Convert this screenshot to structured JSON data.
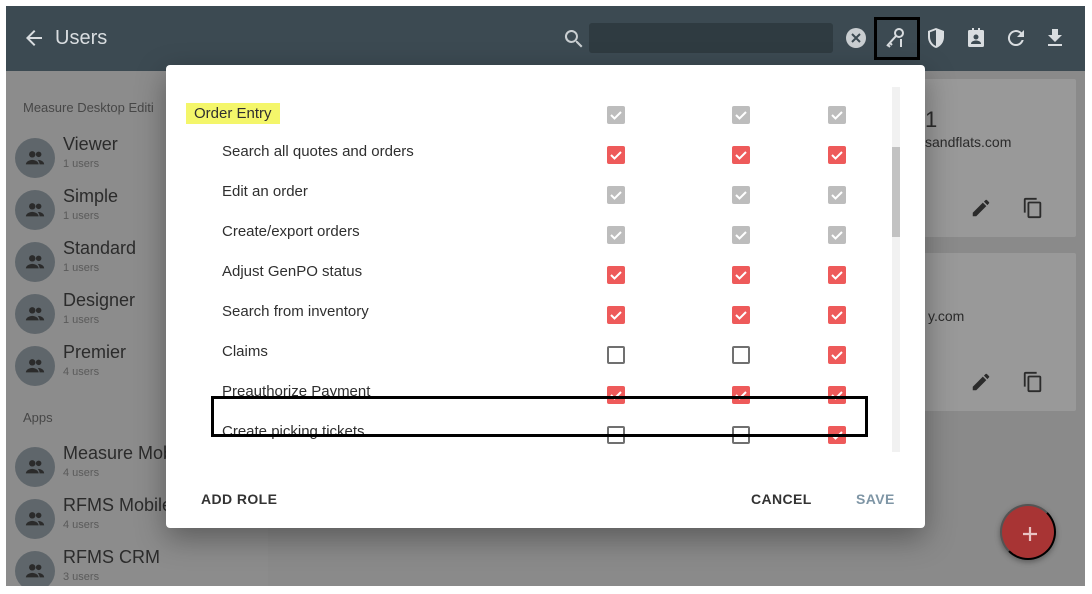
{
  "appbar": {
    "title": "Users",
    "search_value": "",
    "icons": [
      "back-arrow-icon",
      "search-icon",
      "clear-icon",
      "key-permissions-icon",
      "shield-icon",
      "contact-card-icon",
      "refresh-icon",
      "download-icon"
    ]
  },
  "sidebar": {
    "section1_label": "Measure Desktop Editi",
    "section1_items": [
      {
        "name": "Viewer",
        "count": "1 users"
      },
      {
        "name": "Simple",
        "count": "1 users"
      },
      {
        "name": "Standard",
        "count": "1 users"
      },
      {
        "name": "Designer",
        "count": "1 users"
      },
      {
        "name": "Premier",
        "count": "4 users"
      }
    ],
    "section2_label": "Apps",
    "section2_items": [
      {
        "name": "Measure Mob",
        "count": "4 users"
      },
      {
        "name": "RFMS Mobile",
        "count": "4 users"
      },
      {
        "name": "RFMS CRM",
        "count": "3 users"
      }
    ]
  },
  "main": {
    "card1_number": "1",
    "card1_email": "sandflats.com",
    "card2_email": "y.com"
  },
  "dialog": {
    "group_label": "Order Entry",
    "rows": [
      {
        "label": "Search all quotes and orders",
        "checks": [
          "red",
          "red",
          "red"
        ]
      },
      {
        "label": "Edit an order",
        "checks": [
          "grey",
          "grey",
          "grey"
        ]
      },
      {
        "label": "Create/export orders",
        "checks": [
          "grey",
          "grey",
          "grey"
        ]
      },
      {
        "label": "Adjust GenPO status",
        "checks": [
          "red",
          "red",
          "red"
        ]
      },
      {
        "label": "Search from inventory",
        "checks": [
          "red",
          "red",
          "red"
        ]
      },
      {
        "label": "Claims",
        "checks": [
          "empty",
          "empty",
          "red"
        ]
      },
      {
        "label": "Preauthorize Payment",
        "checks": [
          "red",
          "red",
          "red"
        ]
      },
      {
        "label": "Create picking tickets",
        "checks": [
          "empty",
          "empty",
          "red"
        ]
      }
    ],
    "group_checks": [
      "grey",
      "grey",
      "grey"
    ],
    "actions": {
      "add_role": "ADD ROLE",
      "cancel": "CANCEL",
      "save": "SAVE"
    }
  },
  "colors": {
    "appbar": "#3c4a52",
    "checked_red": "#ee5a5a",
    "checked_grey": "#bdbdbd",
    "highlight_yellow": "#f4f66a",
    "fab_red": "#a83434"
  }
}
